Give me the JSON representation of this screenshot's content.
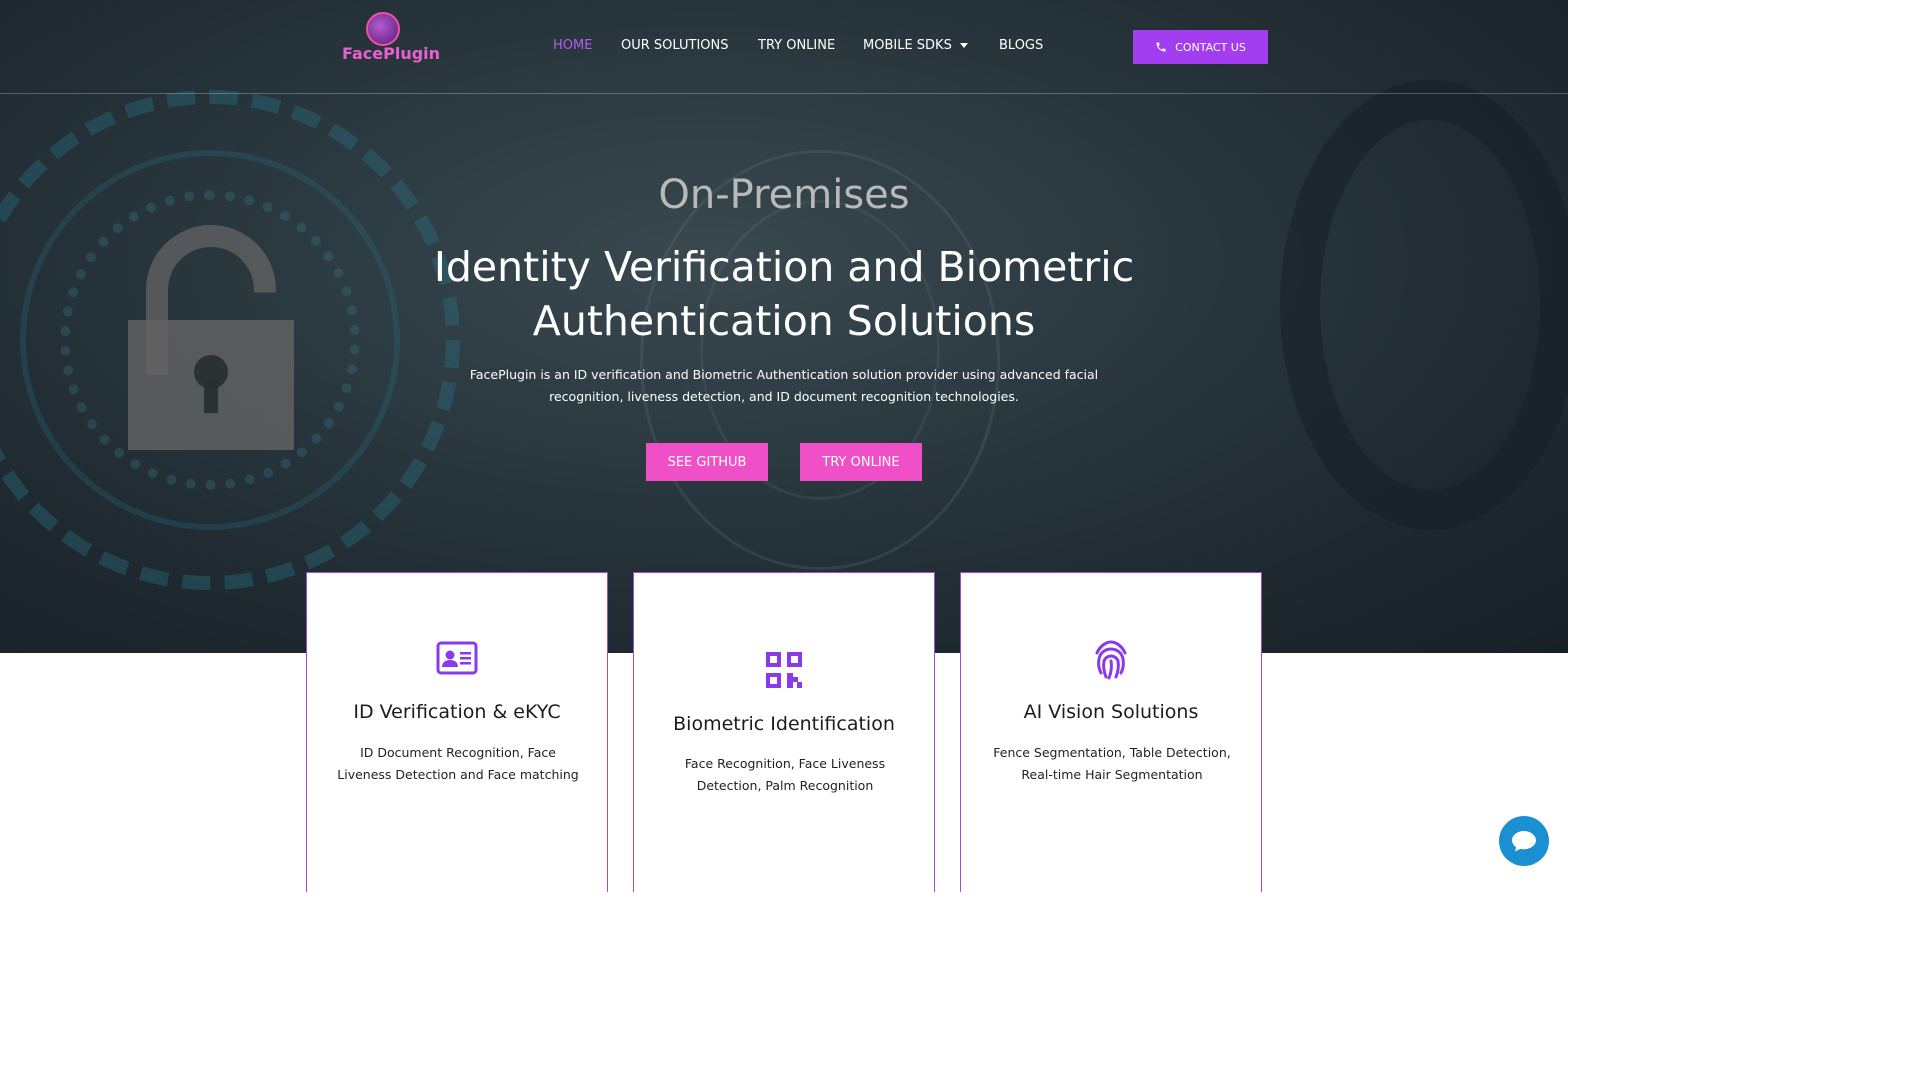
{
  "brand": {
    "name": "FacePlugin"
  },
  "nav": {
    "items": [
      {
        "label": "HOME",
        "active": true
      },
      {
        "label": "OUR SOLUTIONS"
      },
      {
        "label": "TRY ONLINE"
      },
      {
        "label": "MOBILE SDKS",
        "has_dropdown": true
      },
      {
        "label": "BLOGS"
      }
    ],
    "contact_label": "CONTACT US",
    "contact_icon": "phone-icon"
  },
  "hero": {
    "kicker": "On-Premises",
    "title": "Identity Verification and Biometric Authentication Solutions",
    "subtitle": "FacePlugin is an ID verification and Biometric Authentication solution provider using advanced facial recognition, liveness detection, and ID document recognition technologies.",
    "buttons": [
      "SEE GITHUB",
      "TRY ONLINE"
    ]
  },
  "cards": [
    {
      "icon": "id-card-icon",
      "title": "ID Verification & eKYC",
      "description": "ID Document Recognition, Face Liveness Detection and Face matching"
    },
    {
      "icon": "qr-code-icon",
      "title": "Biometric Identification",
      "description": "Face Recognition, Face Liveness Detection, Palm Recognition"
    },
    {
      "icon": "fingerprint-icon",
      "title": "AI Vision Solutions",
      "description": "Fence Segmentation, Table Detection, Real-time Hair Segmentation"
    }
  ],
  "colors": {
    "accent_purple": "#a33ef0",
    "button_pink": "#f050c7",
    "icon_purple": "#8a3ae8",
    "card_border": "#9c4fd6",
    "chat_blue": "#1a8fd1"
  },
  "chat": {
    "icon": "chat-bubble-icon"
  }
}
